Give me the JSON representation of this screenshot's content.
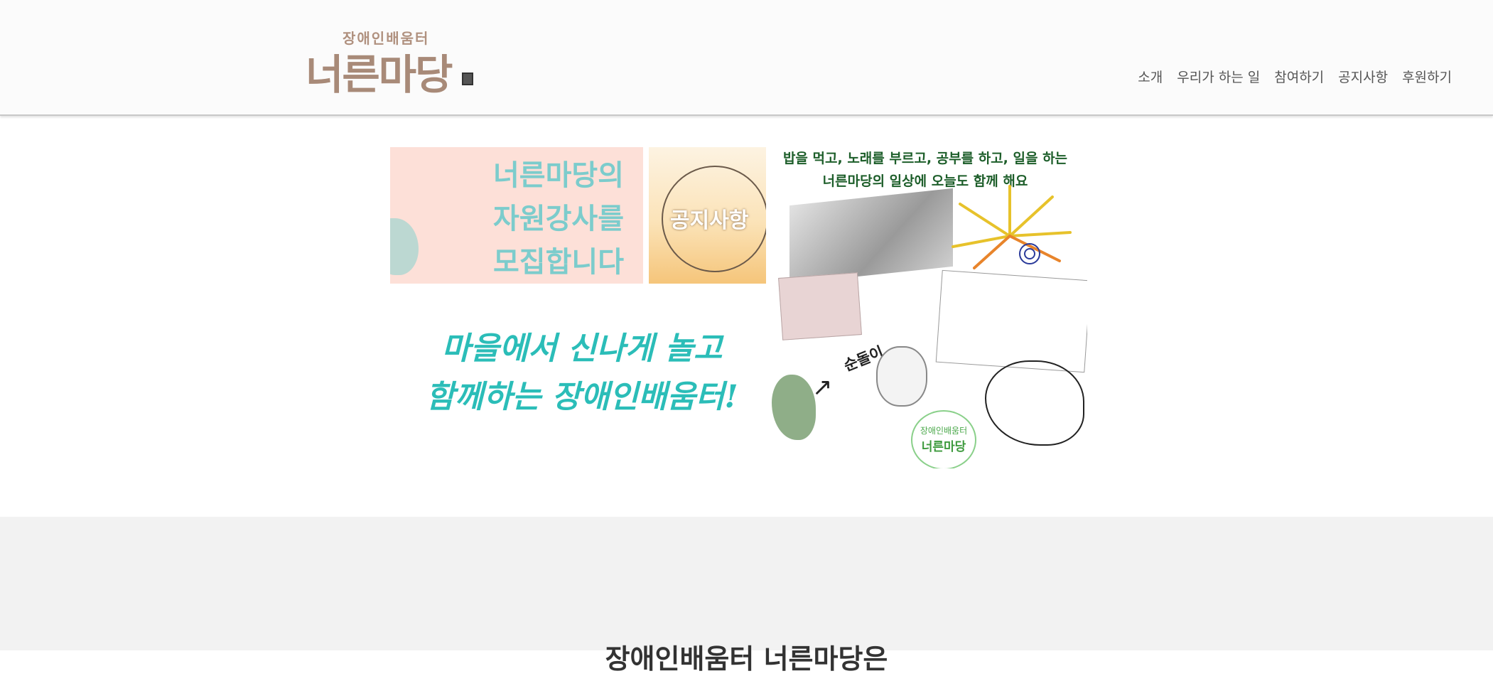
{
  "header": {
    "logo_sub": "장애인배움터",
    "logo_main": "너른마당"
  },
  "nav": {
    "items": [
      "소개",
      "우리가 하는 일",
      "참여하기",
      "공지사항",
      "후원하기"
    ]
  },
  "banner": {
    "recruit_lines": [
      "너른마당의",
      "자원강사를",
      "모집합니다"
    ],
    "notice_label": "공지사항",
    "tagline_lines": [
      "마을에서 신나게 놀고",
      "함께하는 장애인배움터!"
    ],
    "photo_caption_lines": [
      "밥을 먹고, 노래를 부르고, 공부를 하고, 일을 하는",
      "너른마당의 일상에 오늘도 함께 해요"
    ],
    "dog_name": "순돌이",
    "stamp_sub": "장애인배움터",
    "stamp_main": "너른마당"
  },
  "section": {
    "title": "장애인배움터 너른마당은"
  },
  "colors": {
    "logo": "#a88a78",
    "accent_teal": "#2bbdb8",
    "recruit_bg": "#fde0d8",
    "grey_bg": "#f2f2f2"
  }
}
